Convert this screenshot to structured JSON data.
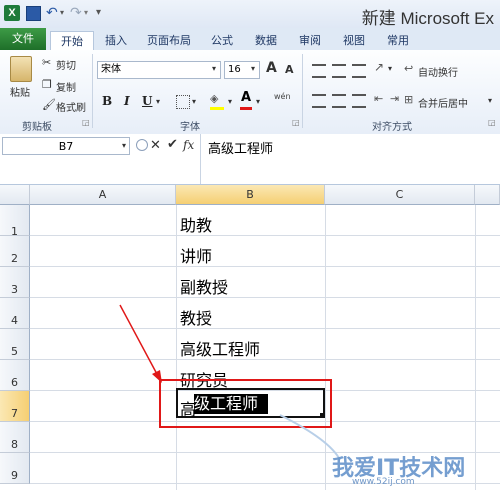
{
  "window": {
    "title": "新建 Microsoft Ex"
  },
  "tabs": [
    "文件",
    "开始",
    "插入",
    "页面布局",
    "公式",
    "数据",
    "审阅",
    "视图",
    "常用"
  ],
  "ribbon": {
    "clipboard": {
      "paste": "粘贴",
      "cut": "剪切",
      "copy": "复制",
      "format_painter": "格式刷",
      "group_label": "剪贴板"
    },
    "font": {
      "family": "宋体",
      "size": "16",
      "grow": "A",
      "shrink": "A",
      "bold": "B",
      "italic": "I",
      "underline": "U",
      "group_label": "字体",
      "wen": "wén"
    },
    "alignment": {
      "wrap": "自动换行",
      "merge": "合并后居中",
      "group_label": "对齐方式"
    }
  },
  "formula_bar": {
    "name_box": "B7",
    "fx": "fx",
    "value": "高级工程师"
  },
  "grid": {
    "columns": [
      "A",
      "B",
      "C"
    ],
    "rows": [
      "1",
      "2",
      "3",
      "4",
      "5",
      "6",
      "7",
      "8",
      "9"
    ],
    "column_b": [
      "助教",
      "讲师",
      "副教授",
      "教授",
      "高级工程师",
      "研究员",
      ""
    ],
    "editing_cell": {
      "prefix": "高",
      "selected": "级工程师"
    }
  },
  "watermark": {
    "text": "我爱IT技术网",
    "url": "www.52ij.com"
  },
  "colors": {
    "annotation_red": "#e01818",
    "file_tab_green": "#2e8b3a",
    "watermark_blue": "#5d8ec8"
  }
}
